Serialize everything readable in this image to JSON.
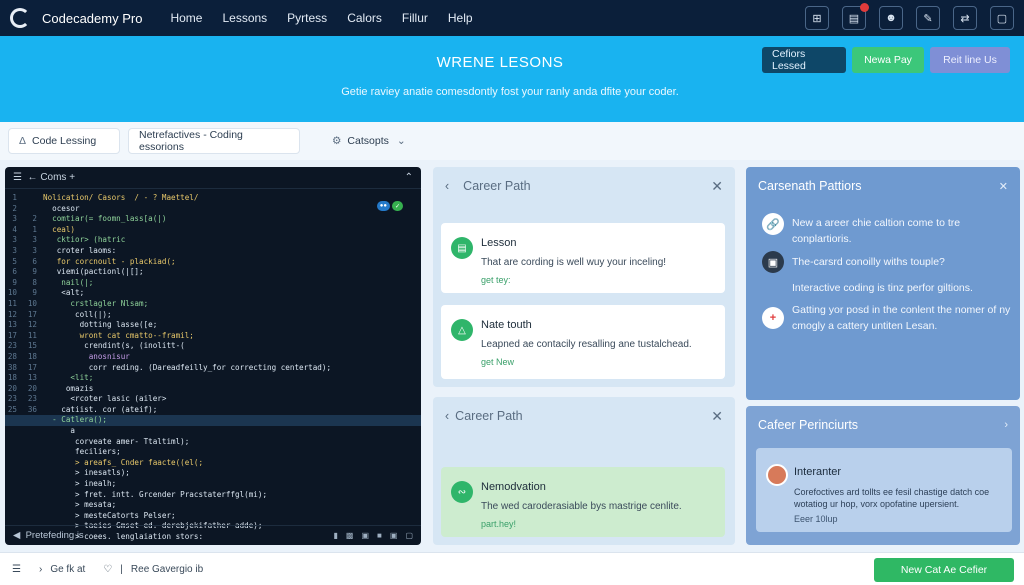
{
  "nav": {
    "brand": "Codecademy Pro",
    "links": [
      "Home",
      "Lessons",
      "Pyrtess",
      "Calors",
      "Fillur",
      "Help"
    ],
    "icons": [
      "grid-icon",
      "document-icon",
      "user-icon",
      "pen-icon",
      "share-icon",
      "window-icon"
    ]
  },
  "hero": {
    "title": "WRENE LESONS",
    "subtitle": "Getie raviey anatie comesdontly fost your ranly anda dfite your coder.",
    "buttons": [
      "Cefiors Lessed",
      "Newa Pay",
      "Reit line Us"
    ]
  },
  "tabs": {
    "tab1": "Code Lessing",
    "tab2": "Netrefactives - Coding essorions",
    "tab3": "Catsopts"
  },
  "editor": {
    "header": "Coms",
    "footer": "Pretefeding is",
    "lines": [
      {
        "n": "1",
        "m": "",
        "t": "Nolication/ Casors  / - ? Maettel/"
      },
      {
        "n": "2",
        "m": "",
        "t": "  ocesor"
      },
      {
        "n": "3",
        "m": "2",
        "t": "  comtiar(= foomn_lass[a(|)"
      },
      {
        "n": "4",
        "m": "1",
        "t": "  ceal)"
      },
      {
        "n": "3",
        "m": "3",
        "t": "   cktior> (hatric"
      },
      {
        "n": "3",
        "m": "3",
        "t": "   croter laoms:"
      },
      {
        "n": "5",
        "m": "6",
        "t": "   for corcnoult - plackiad(;"
      },
      {
        "n": "6",
        "m": "9",
        "t": "   viemi(pactionl(|[];"
      },
      {
        "n": "9",
        "m": "8",
        "t": "    nail(|;"
      },
      {
        "n": "10",
        "m": "9",
        "t": "    <alt;"
      },
      {
        "n": "11",
        "m": "10",
        "t": "      crstlagler Nlsam;"
      },
      {
        "n": "12",
        "m": "17",
        "t": "       coll(|);"
      },
      {
        "n": "13",
        "m": "12",
        "t": "        dotting lasse([e;"
      },
      {
        "n": "17",
        "m": "11",
        "t": "        wront cat cmatto--framil;"
      },
      {
        "n": "23",
        "m": "15",
        "t": "         crendint(s, (inolitt-("
      },
      {
        "n": "28",
        "m": "18",
        "t": "          anosnisur"
      },
      {
        "n": "38",
        "m": "17",
        "t": "          corr reding. (Dareadfeilly_for correcting centertad);"
      },
      {
        "n": "18",
        "m": "13",
        "t": "      <lit;"
      },
      {
        "n": "20",
        "m": "20",
        "t": "     omazis"
      },
      {
        "n": "23",
        "m": "23",
        "t": "      <rcoter lasic (ailer>"
      },
      {
        "n": "25",
        "m": "36",
        "t": "    catiist. cor (ateif);"
      },
      {
        "n": "",
        "m": "",
        "t": "  - Catlera();",
        "hl": true
      },
      {
        "n": "",
        "m": "",
        "t": "      a"
      },
      {
        "n": "",
        "m": "",
        "t": "       corveate amer- Ttaltiml);"
      },
      {
        "n": "",
        "m": "",
        "t": "       feciliers;"
      },
      {
        "n": "",
        "m": "",
        "t": "       > areafs_ Cnder faacte((el(;"
      },
      {
        "n": "",
        "m": "",
        "t": "       > inesatls);"
      },
      {
        "n": "",
        "m": "",
        "t": "       > inealh;"
      },
      {
        "n": "",
        "m": "",
        "t": "       > fret. intt. Grcender Pracstaterffgl(mi);"
      },
      {
        "n": "",
        "m": "",
        "t": "       > mesata;"
      },
      {
        "n": "",
        "m": "",
        "t": "       > mesteCatorts Pelser;"
      },
      {
        "n": "",
        "m": "",
        "t": "       > taeies Gmset ed. derebjekifather adde);"
      },
      {
        "n": "",
        "m": "",
        "t": "       > coees. lenglaiation stors:"
      }
    ]
  },
  "career_panel_1": {
    "title": "Career Path",
    "cards": [
      {
        "title": "Lesson",
        "text": "That are cording is well wuy your inceling!",
        "link": "get tey:"
      },
      {
        "title": "Nate touth",
        "text": "Leapned ae contacily resalling ane tustalchead.",
        "link": "get New"
      }
    ]
  },
  "career_panel_2": {
    "title": "Career Path",
    "card": {
      "title": "Nemodvation",
      "text": "The wed caroderasiable bys mastrige cenlite.",
      "link": "part.hey!"
    }
  },
  "right_panel_1": {
    "title": "Carsenath Pattiors",
    "items": [
      {
        "text": "New a areer chie caltion come to tre conplartioris.",
        "icon": "link-icon"
      },
      {
        "text": "The-carsrd conoilly withs touple?",
        "icon": "box-icon"
      },
      {
        "text": "Interactive coding is tinz perfor giltions.",
        "icon": ""
      },
      {
        "text": "Gatting yor posd in the conlent the nomer of ny cmogly a cattery untiten Lesan.",
        "icon": "plus-icon"
      }
    ]
  },
  "right_panel_2": {
    "title": "Cafeer Perinciurts",
    "card": {
      "title": "Interanter",
      "text": "Corefoctives ard tollts ee fesil chastige datch coe wotatiog ur hop, vorx opofatine upersient.",
      "foot": "Eeer 10lup"
    }
  },
  "bottom": {
    "item1": "Ge fk at",
    "item2": "Ree Gavergio ib",
    "cta": "New Cat Ae Cefier"
  }
}
